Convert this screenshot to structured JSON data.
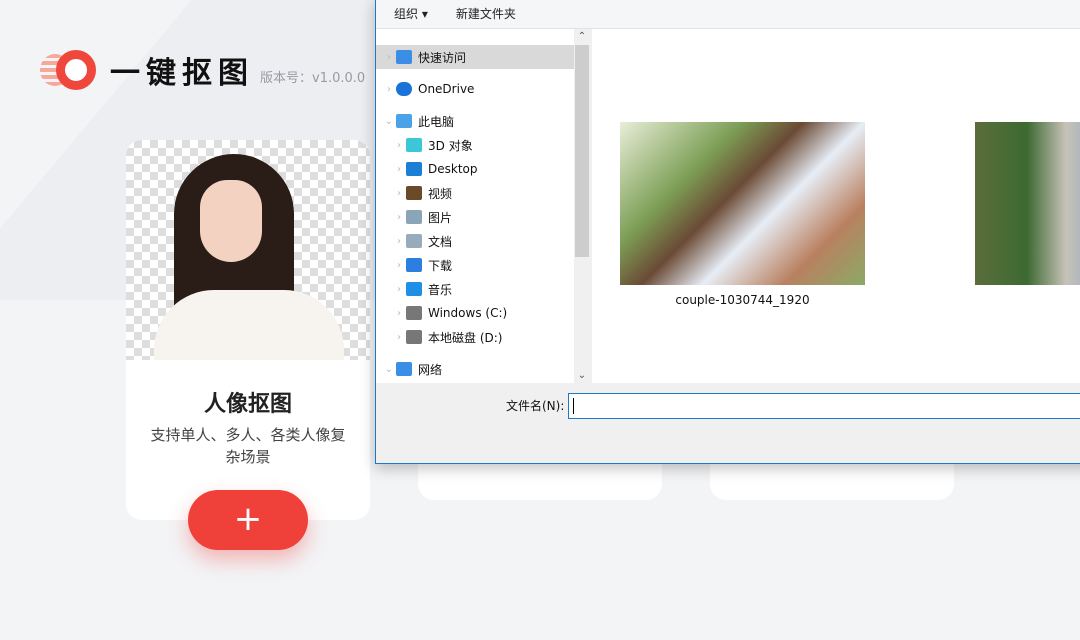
{
  "app": {
    "title": "一键抠图",
    "version": "版本号：v1.0.0.0"
  },
  "cards": [
    {
      "title": "人像抠图",
      "desc": "支持单人、多人、各类人像复杂场景",
      "add_label": "+"
    }
  ],
  "dialog": {
    "toolbar": {
      "organize": "组织 ▾",
      "new_folder": "新建文件夹"
    },
    "nav": [
      {
        "label": "快速访问",
        "icon": "star-icon"
      },
      {
        "label": "OneDrive",
        "icon": "cloud-icon"
      },
      {
        "label": "此电脑",
        "icon": "computer-icon"
      },
      {
        "label": "3D 对象",
        "icon": "cube-icon"
      },
      {
        "label": "Desktop",
        "icon": "desktop-icon"
      },
      {
        "label": "视频",
        "icon": "film-icon"
      },
      {
        "label": "图片",
        "icon": "picture-icon"
      },
      {
        "label": "文档",
        "icon": "document-icon"
      },
      {
        "label": "下载",
        "icon": "download-icon"
      },
      {
        "label": "音乐",
        "icon": "music-icon"
      },
      {
        "label": "Windows (C:)",
        "icon": "drive-icon"
      },
      {
        "label": "本地磁盘 (D:)",
        "icon": "drive-icon"
      },
      {
        "label": "网络",
        "icon": "network-icon"
      }
    ],
    "files": [
      {
        "name": "couple-1030744_1920"
      },
      {
        "name": ""
      }
    ],
    "filename_label": "文件名(N):",
    "filename_value": ""
  },
  "colors": {
    "accent": "#f0403a",
    "dialog_border": "#1979ca"
  }
}
